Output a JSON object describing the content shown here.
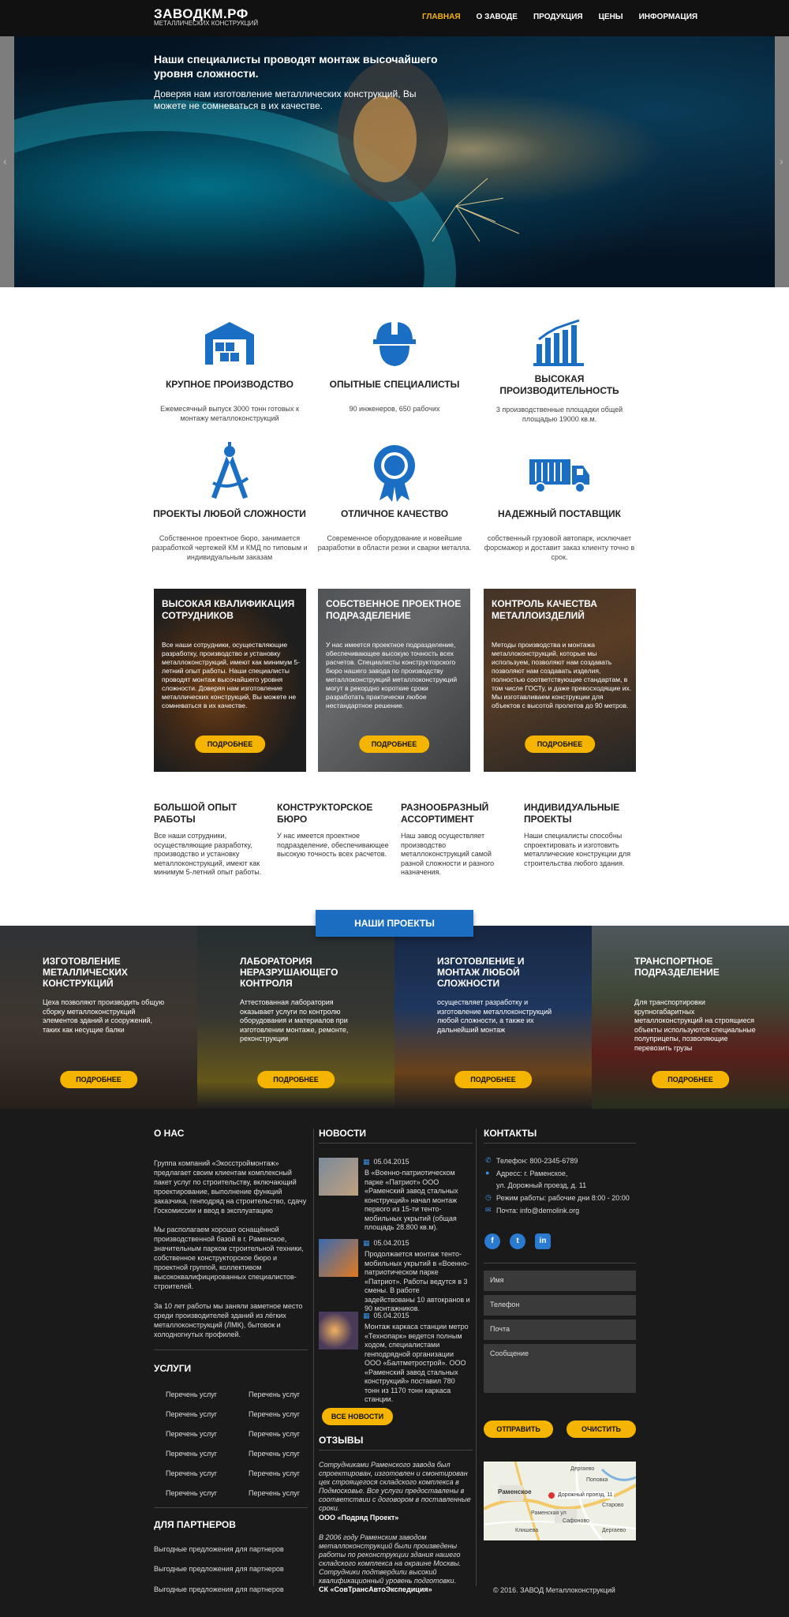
{
  "header": {
    "logo_title": "ЗАВОДКМ.РФ",
    "logo_sub": "МЕТАЛЛИЧЕСКИХ КОНСТРУКЦИЙ",
    "nav": [
      "ГЛАВНАЯ",
      "О ЗАВОДЕ",
      "ПРОДУКЦИЯ",
      "ЦЕНЫ",
      "ИНФОРМАЦИЯ"
    ]
  },
  "hero": {
    "title": "Наши специалисты проводят монтаж высочайшего уровня сложности.",
    "text": "Доверяя нам изготовление металлических конструкций, Вы можете не сомневаться в их качестве.",
    "prev": "‹",
    "next": "›"
  },
  "features": [
    {
      "icon": "warehouse-icon",
      "title": "КРУПНОЕ ПРОИЗВОДСТВО",
      "text": "Ежемесячный выпуск 3000 тонн готовых к монтажу металлоконструкций"
    },
    {
      "icon": "worker-helmet-icon",
      "title": "ОПЫТНЫЕ СПЕЦИАЛИСТЫ",
      "text": "90 инженеров, 650 рабочих"
    },
    {
      "icon": "bar-growth-icon",
      "title": "ВЫСОКАЯ ПРОИЗВОДИТЕЛЬНОСТЬ",
      "text": "3 производственные площадки общей площадью 19000 кв.м."
    },
    {
      "icon": "compass-icon",
      "title": "ПРОЕКТЫ ЛЮБОЙ СЛОЖНОСТИ",
      "text": "Собственное проектное бюро, занимается разработкой чертежей КМ и КМД по типовым и индивидуальным заказам"
    },
    {
      "icon": "quality-badge-icon",
      "title": "ОТЛИЧНОЕ КАЧЕСТВО",
      "text": "Современное оборудование и новейшие разработки в области резки и сварки металла."
    },
    {
      "icon": "truck-icon",
      "title": "НАДЕЖНЫЙ ПОСТАВЩИК",
      "text": "собственный грузовой автопарк, исключает форсмажор и доставит заказ клиенту точно в срок."
    }
  ],
  "cards": [
    {
      "title": "ВЫСОКАЯ КВАЛИФИКАЦИЯ СОТРУДНИКОВ",
      "text": "Все наши сотрудники, осуществляющие разработку, производство и установку металлоконструкций, имеют как минимум 5-летний опыт работы. Наши специалисты проводят монтаж высочайшего уровня сложности. Доверяя нам изготовление металлических конструкций, Вы можете не сомневаться в их качестве.",
      "button": "ПОДРОБНЕЕ"
    },
    {
      "title": "СОБСТВЕННОЕ ПРОЕКТНОЕ ПОДРАЗДЕЛЕНИЕ",
      "text": "У нас имеется проектное подразделение, обеспечивающее высокую точность всех расчетов. Специалисты конструкторского бюро нашего завода по производству металлоконструкций металлоконструкций могут в рекордно короткие сроки разработать практически любое нестандартное решение.",
      "button": "ПОДРОБНЕЕ"
    },
    {
      "title": "КОНТРОЛЬ КАЧЕСТВА МЕТАЛЛОИЗДЕЛИЙ",
      "text": "Методы производства и монтажа металлоконструкций, которые мы используем, позволяют нам создавать позволяют нам создавать изделия, полностью соответствующие стандартам, в том числе ГОСТу, и даже превосходящие их. Мы изготавливаем конструкции для объектов с высотой пролетов до 90 метров.",
      "button": "ПОДРОБНЕЕ"
    }
  ],
  "advantages": [
    {
      "title": "БОЛЬШОЙ ОПЫТ РАБОТЫ",
      "text": "Все наши сотрудники, осуществляющие разработку, производство и установку металлоконструкций, имеют как минимум 5-летний опыт работы."
    },
    {
      "title": "КОНСТРУКТОРСКОЕ БЮРО",
      "text": "У нас имеется проектное подразделение, обеспечивающее высокую точность всех расчетов."
    },
    {
      "title": "РАЗНООБРАЗНЫЙ АССОРТИМЕНТ",
      "text": "Наш завод осуществляет производство металлоконструкций самой разной сложности и разного назначения."
    },
    {
      "title": "ИНДИВИДУАЛЬНЫЕ ПРОЕКТЫ",
      "text": "Наши специалисты способны спроектировать и изготовить металлические конструкции для строительства любого здания."
    }
  ],
  "projects_button": "НАШИ ПРОЕКТЫ",
  "projects": [
    {
      "title": "ИЗГОТОВЛЕНИЕ МЕТАЛЛИЧЕСКИХ КОНСТРУКЦИЙ",
      "text": "Цеха позволяют производить общую сборку металлоконструкций элементов зданий и сооружений, таких как несущие балки",
      "button": "ПОДРОБНЕЕ"
    },
    {
      "title": "ЛАБОРАТОРИЯ НЕРАЗРУШАЮЩЕГО КОНТРОЛЯ",
      "text": "Аттестованная лаборатория оказывает услуги по контролю оборудования и материалов при изготовлении монтаже, ремонте, реконструкции",
      "button": "ПОДРОБНЕЕ"
    },
    {
      "title": "ИЗГОТОВЛЕНИЕ И МОНТАЖ ЛЮБОЙ СЛОЖНОСТИ",
      "text": "осуществляет разработку и изготовление металлоконструкций любой сложности, а также их дальнейший монтаж",
      "button": "ПОДРОБНЕЕ"
    },
    {
      "title": "ТРАНСПОРТНОЕ ПОДРАЗДЕЛЕНИЕ",
      "text": "Для транспортировки крупногабаритных металлоконструкций на строящиеся объекты используются специальные полуприцепы, позволяющие перевозить грузы",
      "button": "ПОДРОБНЕЕ"
    }
  ],
  "footer": {
    "about": {
      "title": "О НАС",
      "p1": "Группа компаний «Экосстроймонтаж» предлагает своим клиентам комплексный пакет услуг по строительству, включающий проектирование, выполнение функций заказчика, генподряд на строительство, сдачу Госкомиссии и ввод в эксплуатацию",
      "p2": "Мы располагаем хорошо оснащённой производственной базой в г. Раменское, значительным парком строительной техники, собственное конструкторское бюро и проектной группой, коллективом высококвалифицированных специалистов-строителей.",
      "p3": "За 10 лет работы мы заняли заметное место среди производителей зданий из лёгких металлоконструкций (ЛМК), бытовок и холодногнутых профилей."
    },
    "services": {
      "title": "УСЛУГИ",
      "items": [
        "Перечень услуг",
        "Перечень услуг",
        "Перечень услуг",
        "Перечень услуг",
        "Перечень услуг",
        "Перечень услуг",
        "Перечень услуг",
        "Перечень услуг",
        "Перечень услуг",
        "Перечень услуг",
        "Перечень услуг",
        "Перечень услуг"
      ]
    },
    "partners": {
      "title": "ДЛЯ ПАРТНЕРОВ",
      "items": [
        "Выгодные предложения для партнеров",
        "Выгодные предложения для партнеров",
        "Выгодные предложения для партнеров"
      ]
    },
    "news": {
      "title": "НОВОСТИ",
      "items": [
        {
          "date": "05.04.2015",
          "text": "В «Военно-патриотическом парке «Патриот» ООО «Раменский завод стальных конструкций» начал монтаж первого из 15-ти тенто-мобильных укрытий (общая площадь 28.800 кв.м)."
        },
        {
          "date": "05.04.2015",
          "text": "Продолжается монтаж тенто-мобильных укрытий в «Военно-патриотическом парке «Патриот». Работы ведутся в 3 смены. В работе задействованы 10 автокранов и 90 монтажников."
        },
        {
          "date": "05.04.2015",
          "text": "Монтаж каркаса станции метро «Технопарк» ведется полным ходом, специалистами генподрядной организации ООО «Балтметрострой». ООО «Раменский завод стальных конструкций» поставил 780 тонн из 1170 тонн каркаса станции."
        }
      ],
      "all_button": "ВСЕ НОВОСТИ"
    },
    "reviews": {
      "title": "ОТЗЫВЫ",
      "items": [
        {
          "text": "Сотрудниками Раменского завода был спроектирован, изготовлен и смонтирован цех строящегося складского комплекса в Подмосковье. Все услуги предоставлены в соответствии с договором в поставленные сроки.",
          "author": "ООО «Подряд Проект»"
        },
        {
          "text": "В 2006 году Раменским заводом металлоконструкций были произведены работы по реконструкции здания нашего складского комплекса на окраине Москвы. Сотрудники подтвердили высокий квалификационный уровень подготовки.",
          "author": "СК «СовТрансАвтоЭкспедиция»"
        }
      ]
    },
    "contacts": {
      "title": "КОНТАКТЫ",
      "phone": "Телефон: 800-2345-6789",
      "address1": "Адресс:  г. Раменское,",
      "address2": "ул. Дорожный проезд, д. 11",
      "hours": "Режим работы: рабочие дни 8:00 - 20:00",
      "email": "Почта: info@demolink.org"
    },
    "social": [
      "f",
      "t",
      "in"
    ],
    "form": {
      "name": "Имя",
      "phone": "Телефон",
      "email": "Почта",
      "message": "Сообщение",
      "send": "ОТПРАВИТЬ",
      "clear": "ОЧИСТИТЬ"
    },
    "map": {
      "labels": [
        "Дергаево",
        "Поповка",
        "Раменское",
        "Дорожный проезд, 11",
        "Старово",
        "Сафоново",
        "Клишева",
        "Дергаево",
        "Раменская ул"
      ]
    },
    "copyright": "© 2016. ЗАВОД Металлоконструкций"
  },
  "colors": {
    "accent": "#f5b400",
    "blue": "#1b6dc1",
    "icon_blue": "#1a6fc4",
    "footer_bg": "#1a1a1a"
  }
}
